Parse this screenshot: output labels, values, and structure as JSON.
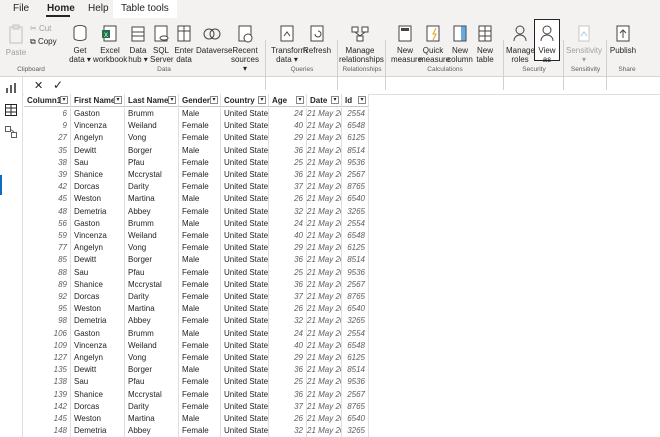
{
  "tabs": {
    "file": "File",
    "home": "Home",
    "help": "Help",
    "table_tools": "Table tools"
  },
  "ribbon": {
    "clipboard": {
      "paste": "Paste",
      "cut": "Cut",
      "copy": "Copy",
      "group": "Clipboard"
    },
    "data": {
      "get_data": "Get data ▾",
      "excel": "Excel workbook",
      "data_hub": "Data hub ▾",
      "sql": "SQL Server",
      "enter": "Enter data",
      "dataverse": "Dataverse",
      "recent": "Recent sources ▾",
      "group": "Data"
    },
    "queries": {
      "transform": "Transform data ▾",
      "refresh": "Refresh",
      "group": "Queries"
    },
    "relationships": {
      "manage": "Manage relationships",
      "group": "Relationships"
    },
    "calculations": {
      "new_measure": "New measure",
      "quick_measure": "Quick measure",
      "new_column": "New column",
      "new_table": "New table",
      "group": "Calculations"
    },
    "security": {
      "manage_roles": "Manage roles",
      "view_as": "View as",
      "group": "Security"
    },
    "sensitivity": {
      "label": "Sensitivity ▾",
      "group": "Sensitivity"
    },
    "share": {
      "publish": "Publish",
      "group": "Share"
    }
  },
  "formula": {
    "cancel": "✕",
    "commit": "✓"
  },
  "table": {
    "columns": [
      "Column1",
      "First Name",
      "Last Name",
      "Gender",
      "Country",
      "Age",
      "Date",
      "Id"
    ],
    "rows": [
      [
        "6",
        "Gaston",
        "Brumm",
        "Male",
        "United States",
        "24",
        "21 May 2015",
        "2554"
      ],
      [
        "9",
        "Vincenza",
        "Weiland",
        "Female",
        "United States",
        "40",
        "21 May 2015",
        "6548"
      ],
      [
        "27",
        "Angelyn",
        "Vong",
        "Female",
        "United States",
        "29",
        "21 May 2015",
        "6125"
      ],
      [
        "35",
        "Dewitt",
        "Borger",
        "Male",
        "United States",
        "36",
        "21 May 2015",
        "8514"
      ],
      [
        "38",
        "Sau",
        "Pfau",
        "Female",
        "United States",
        "25",
        "21 May 2015",
        "9536"
      ],
      [
        "39",
        "Shanice",
        "Mccrystal",
        "Female",
        "United States",
        "36",
        "21 May 2015",
        "2567"
      ],
      [
        "42",
        "Dorcas",
        "Darity",
        "Female",
        "United States",
        "37",
        "21 May 2015",
        "8765"
      ],
      [
        "45",
        "Weston",
        "Martina",
        "Male",
        "United States",
        "26",
        "21 May 2015",
        "6540"
      ],
      [
        "48",
        "Demetria",
        "Abbey",
        "Female",
        "United States",
        "32",
        "21 May 2015",
        "3265"
      ],
      [
        "56",
        "Gaston",
        "Brumm",
        "Male",
        "United States",
        "24",
        "21 May 2015",
        "2554"
      ],
      [
        "59",
        "Vincenza",
        "Weiland",
        "Female",
        "United States",
        "40",
        "21 May 2015",
        "6548"
      ],
      [
        "77",
        "Angelyn",
        "Vong",
        "Female",
        "United States",
        "29",
        "21 May 2015",
        "6125"
      ],
      [
        "85",
        "Dewitt",
        "Borger",
        "Male",
        "United States",
        "36",
        "21 May 2015",
        "8514"
      ],
      [
        "88",
        "Sau",
        "Pfau",
        "Female",
        "United States",
        "25",
        "21 May 2015",
        "9536"
      ],
      [
        "89",
        "Shanice",
        "Mccrystal",
        "Female",
        "United States",
        "36",
        "21 May 2015",
        "2567"
      ],
      [
        "92",
        "Dorcas",
        "Darity",
        "Female",
        "United States",
        "37",
        "21 May 2015",
        "8765"
      ],
      [
        "95",
        "Weston",
        "Martina",
        "Male",
        "United States",
        "26",
        "21 May 2015",
        "6540"
      ],
      [
        "98",
        "Demetria",
        "Abbey",
        "Female",
        "United States",
        "32",
        "21 May 2015",
        "3265"
      ],
      [
        "106",
        "Gaston",
        "Brumm",
        "Male",
        "United States",
        "24",
        "21 May 2015",
        "2554"
      ],
      [
        "109",
        "Vincenza",
        "Weiland",
        "Female",
        "United States",
        "40",
        "21 May 2015",
        "6548"
      ],
      [
        "127",
        "Angelyn",
        "Vong",
        "Female",
        "United States",
        "29",
        "21 May 2015",
        "6125"
      ],
      [
        "135",
        "Dewitt",
        "Borger",
        "Male",
        "United States",
        "36",
        "21 May 2015",
        "8514"
      ],
      [
        "138",
        "Sau",
        "Pfau",
        "Female",
        "United States",
        "25",
        "21 May 2015",
        "9536"
      ],
      [
        "139",
        "Shanice",
        "Mccrystal",
        "Female",
        "United States",
        "36",
        "21 May 2015",
        "2567"
      ],
      [
        "142",
        "Dorcas",
        "Darity",
        "Female",
        "United States",
        "37",
        "21 May 2015",
        "8765"
      ],
      [
        "145",
        "Weston",
        "Martina",
        "Male",
        "United States",
        "26",
        "21 May 2015",
        "6540"
      ],
      [
        "148",
        "Demetria",
        "Abbey",
        "Female",
        "United States",
        "32",
        "21 May 2015",
        "3265"
      ]
    ]
  },
  "colors": {
    "accent": "#0f6cbd",
    "ribbon_bg": "#f3f2f1",
    "grid_line": "#e1dfdd"
  }
}
